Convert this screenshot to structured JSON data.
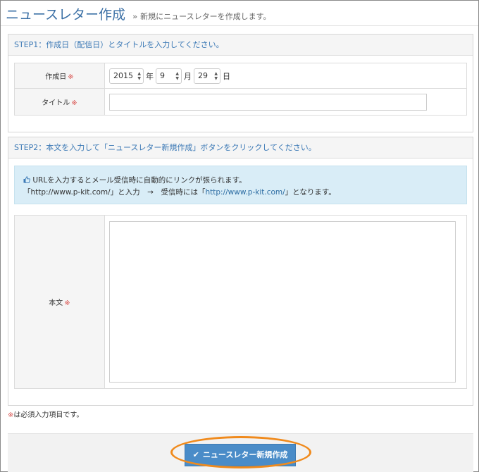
{
  "page": {
    "title": "ニュースレター作成",
    "breadcrumb_sep": "»",
    "subtitle": "新規にニュースレターを作成します。"
  },
  "step1": {
    "heading": "STEP1：作成日（配信日）とタイトルを入力してください。",
    "date_label": "作成日",
    "required_mark": "※",
    "year": "2015",
    "year_unit": "年",
    "month": "9",
    "month_unit": "月",
    "day": "29",
    "day_unit": "日",
    "title_label": "タイトル",
    "title_value": ""
  },
  "step2": {
    "heading": "STEP2：本文を入力して「ニュースレター新規作成」ボタンをクリックしてください。",
    "info_line1": "URLを入力するとメール受信時に自動的にリンクが張られます。",
    "info_line2_a": "「http://www.p-kit.com/」と入力　→　受信時には「",
    "info_link": "http://www.p-kit.com/",
    "info_line2_b": "」となります。",
    "body_label": "本文",
    "body_value": ""
  },
  "footnote": {
    "mark": "※",
    "text": "は必須入力項目です。"
  },
  "submit": {
    "label": "ニュースレター新規作成"
  },
  "icons": {
    "info": "thumbs-up-icon",
    "submit": "check-icon",
    "select_arrow": "updown-arrow-icon"
  },
  "colors": {
    "title": "#3a6fa5",
    "step_heading": "#3a78b5",
    "required": "#d9534f",
    "info_bg": "#d9edf7",
    "button": "#4a8cc8",
    "highlight": "#f08a1c"
  }
}
